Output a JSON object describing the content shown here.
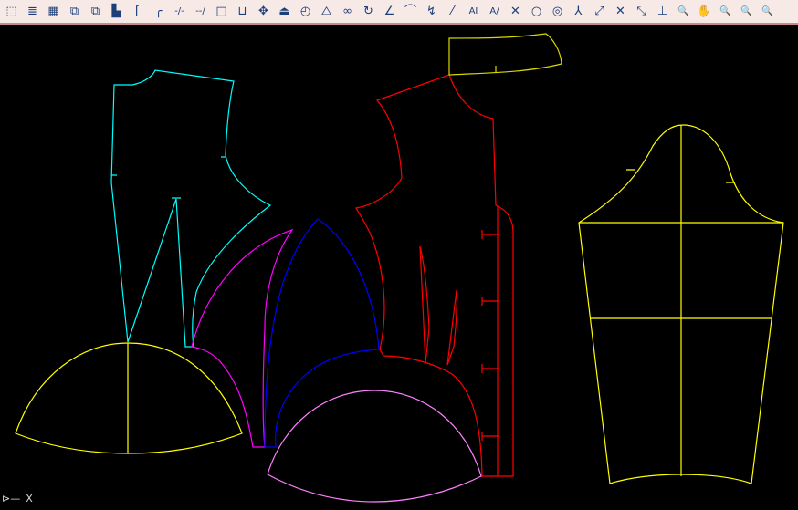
{
  "toolbar": {
    "tools": [
      {
        "icon": "select-window-icon",
        "glyph": "⬚"
      },
      {
        "icon": "layer-list-icon",
        "glyph": "≣"
      },
      {
        "icon": "color-properties-icon",
        "glyph": "▦"
      },
      {
        "icon": "copy-piece-icon",
        "glyph": "⧉"
      },
      {
        "icon": "paste-piece-icon",
        "glyph": "⧉"
      },
      {
        "icon": "ruler-measure-icon",
        "glyph": "▙"
      },
      {
        "icon": "corner-line-icon",
        "glyph": "⌈"
      },
      {
        "icon": "corner-curve-icon",
        "glyph": "╭"
      },
      {
        "icon": "cut-line-icon",
        "glyph": "-/-"
      },
      {
        "icon": "extend-line-icon",
        "glyph": "--/"
      },
      {
        "icon": "rectangle-icon",
        "glyph": "□"
      },
      {
        "icon": "open-rectangle-icon",
        "glyph": "⊔"
      },
      {
        "icon": "move-icon",
        "glyph": "✥"
      },
      {
        "icon": "stamp-icon",
        "glyph": "⏏"
      },
      {
        "icon": "measure-angle-icon",
        "glyph": "◴"
      },
      {
        "icon": "mirror-icon",
        "glyph": "⧋"
      },
      {
        "icon": "link-pieces-icon",
        "glyph": "∞"
      },
      {
        "icon": "rotate-icon",
        "glyph": "↻"
      },
      {
        "icon": "angle-icon",
        "glyph": "∠"
      },
      {
        "icon": "arc-icon",
        "glyph": "⌒"
      },
      {
        "icon": "bezier-curve-icon",
        "glyph": "↯"
      },
      {
        "icon": "line-icon",
        "glyph": "⁄"
      },
      {
        "icon": "text-icon",
        "glyph": "AI"
      },
      {
        "icon": "edit-text-icon",
        "glyph": "A/"
      },
      {
        "icon": "intersect-icon",
        "glyph": "✕"
      },
      {
        "icon": "circle-icon",
        "glyph": "○"
      },
      {
        "icon": "concentric-circle-icon",
        "glyph": "◎"
      },
      {
        "icon": "notch-icon",
        "glyph": "⅄"
      },
      {
        "icon": "point-line-icon",
        "glyph": "⤢"
      },
      {
        "icon": "cross-icon",
        "glyph": "✕"
      },
      {
        "icon": "midpoint-icon",
        "glyph": "⤡"
      },
      {
        "icon": "perpendicular-icon",
        "glyph": "⊥"
      },
      {
        "icon": "zoom-window-icon",
        "glyph": "🔍"
      },
      {
        "icon": "pan-hand-icon",
        "glyph": "✋"
      },
      {
        "icon": "zoom-in-out-icon",
        "glyph": "🔍"
      },
      {
        "icon": "zoom-previous-icon",
        "glyph": "🔍"
      },
      {
        "icon": "zoom-extents-icon",
        "glyph": "🔍"
      }
    ]
  },
  "colors": {
    "cyan": "#00ffff",
    "magenta": "#ff00ff",
    "blue": "#0000ff",
    "red": "#ff0000",
    "yellow": "#ffff00",
    "pink": "#ff80ff",
    "white": "#ffffff"
  },
  "ucs": {
    "axis_label": "X"
  }
}
